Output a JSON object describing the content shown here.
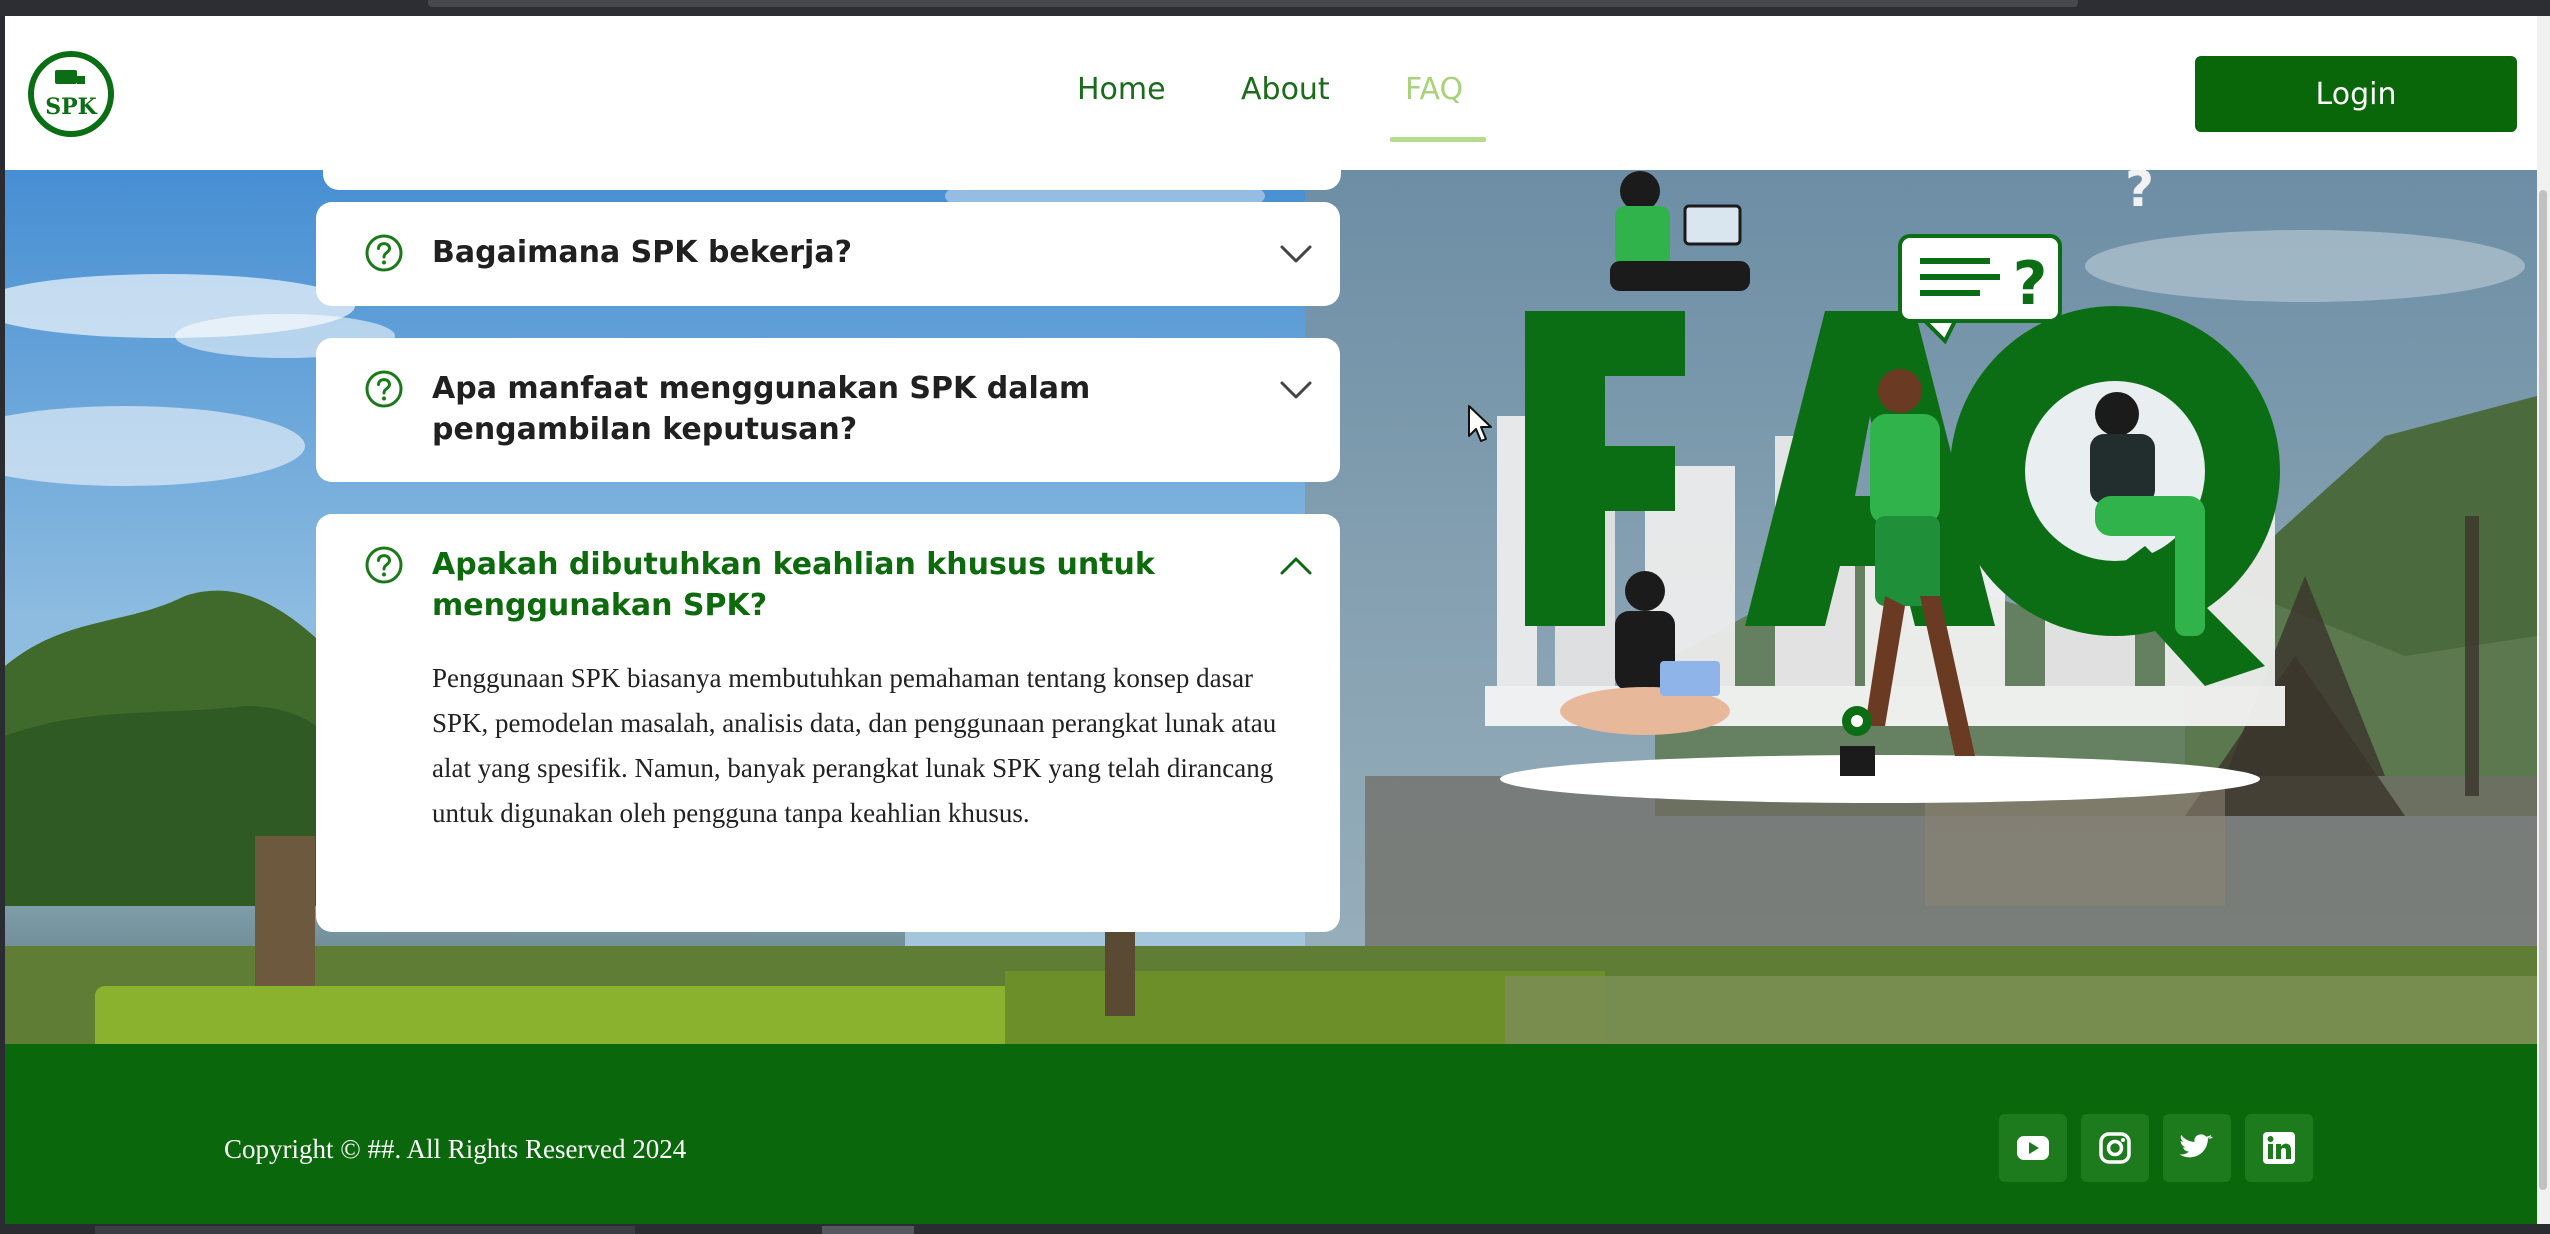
{
  "nav": {
    "logo_text": "SPK",
    "links": [
      "Home",
      "About",
      "FAQ"
    ],
    "active": "FAQ",
    "login_label": "Login"
  },
  "faq": {
    "items": [
      {
        "question": "Bagaimana SPK bekerja?",
        "expanded": false
      },
      {
        "question": "Apa manfaat menggunakan SPK dalam pengambilan keputusan?",
        "expanded": false
      },
      {
        "question": "Apakah dibutuhkan keahlian khusus untuk menggunakan SPK?",
        "expanded": true,
        "answer": "Penggunaan SPK biasanya membutuhkan pemahaman tentang konsep dasar SPK, pemodelan masalah, analisis data, dan penggunaan perangkat lunak atau alat yang spesifik. Namun, banyak perangkat lunak SPK yang telah dirancang untuk digunakan oleh pengguna tanpa keahlian khusus."
      }
    ]
  },
  "illustration": {
    "text": "FAQ"
  },
  "footer": {
    "copyright": "Copyright © ##. All Rights Reserved 2024",
    "social": [
      "youtube-icon",
      "instagram-icon",
      "twitter-icon",
      "linkedin-icon"
    ]
  },
  "colors": {
    "primary": "#0b670b",
    "accent_light": "#a9d27a",
    "person_green": "#2fb34a"
  }
}
